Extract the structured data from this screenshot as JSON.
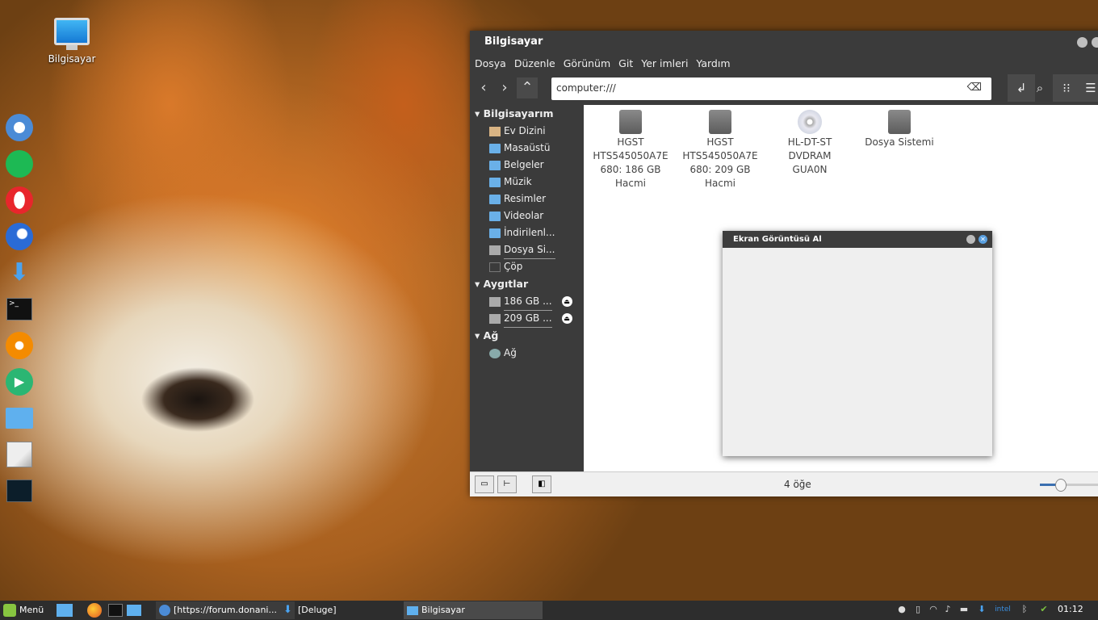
{
  "desktop": {
    "computer_label": "Bilgisayar"
  },
  "window": {
    "title": "Bilgisayar",
    "menu": [
      "Dosya",
      "Düzenle",
      "Görünüm",
      "Git",
      "Yer imleri",
      "Yardım"
    ],
    "address": "computer:///",
    "sidebar": {
      "sections": [
        {
          "title": "Bilgisayarım",
          "items": [
            {
              "label": "Ev Dizini",
              "icon": "home-icon"
            },
            {
              "label": "Masaüstü",
              "icon": "folder-icon"
            },
            {
              "label": "Belgeler",
              "icon": "folder-icon"
            },
            {
              "label": "Müzik",
              "icon": "folder-icon"
            },
            {
              "label": "Resimler",
              "icon": "folder-icon"
            },
            {
              "label": "Videolar",
              "icon": "folder-icon"
            },
            {
              "label": "İndirilenl...",
              "icon": "folder-icon"
            },
            {
              "label": "Dosya Si...",
              "icon": "drive-icon"
            },
            {
              "label": "Çöp",
              "icon": "trash-icon"
            }
          ]
        },
        {
          "title": "Aygıtlar",
          "items": [
            {
              "label": "186 GB ...",
              "icon": "drive-icon",
              "eject": true
            },
            {
              "label": "209 GB ...",
              "icon": "drive-icon",
              "eject": true
            }
          ]
        },
        {
          "title": "Ağ",
          "items": [
            {
              "label": "Ağ",
              "icon": "network-icon"
            }
          ]
        }
      ]
    },
    "files": [
      {
        "label_lines": [
          "HGST",
          "HTS545050A7E",
          "680: 186 GB",
          "Hacmi"
        ],
        "icon": "drive-icon"
      },
      {
        "label_lines": [
          "HGST",
          "HTS545050A7E",
          "680: 209 GB",
          "Hacmi"
        ],
        "icon": "drive-icon"
      },
      {
        "label_lines": [
          "HL-DT-ST",
          "DVDRAM",
          "GUA0N"
        ],
        "icon": "optical-disc-icon"
      },
      {
        "label_lines": [
          "Dosya Sistemi"
        ],
        "icon": "drive-icon"
      }
    ],
    "status": "4 öğe",
    "zoom_fraction": 0.3
  },
  "dialog": {
    "title": "Ekran Görüntüsü Al"
  },
  "panel": {
    "menu_label": "Menü",
    "tasks": [
      "[https://forum.donani...",
      "[Deluge]",
      "Bilgisayar"
    ],
    "clock": "01:12"
  }
}
